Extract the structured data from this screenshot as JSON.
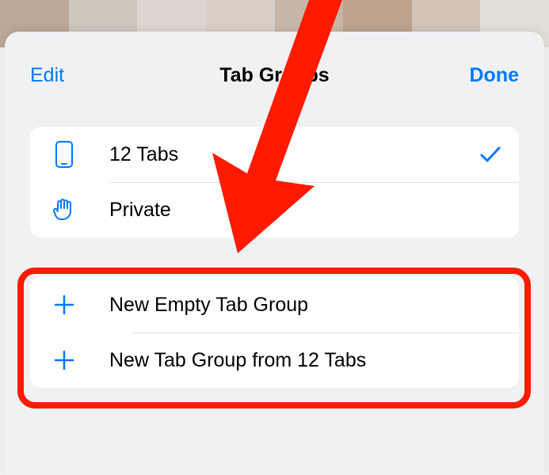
{
  "header": {
    "edit": "Edit",
    "title": "Tab Groups",
    "done": "Done"
  },
  "groups": [
    {
      "label": "12 Tabs",
      "selected": true
    },
    {
      "label": "Private",
      "selected": false
    }
  ],
  "newGroup": {
    "empty": "New Empty Tab Group",
    "fromTabs": "New Tab Group from 12 Tabs"
  },
  "backdrop_colors": [
    "#bca798",
    "#cfc6be",
    "#ddd6cf",
    "#d9cfc6",
    "#c8b7a8",
    "#bda28e",
    "#d2c4b8",
    "#e3ddd7"
  ]
}
